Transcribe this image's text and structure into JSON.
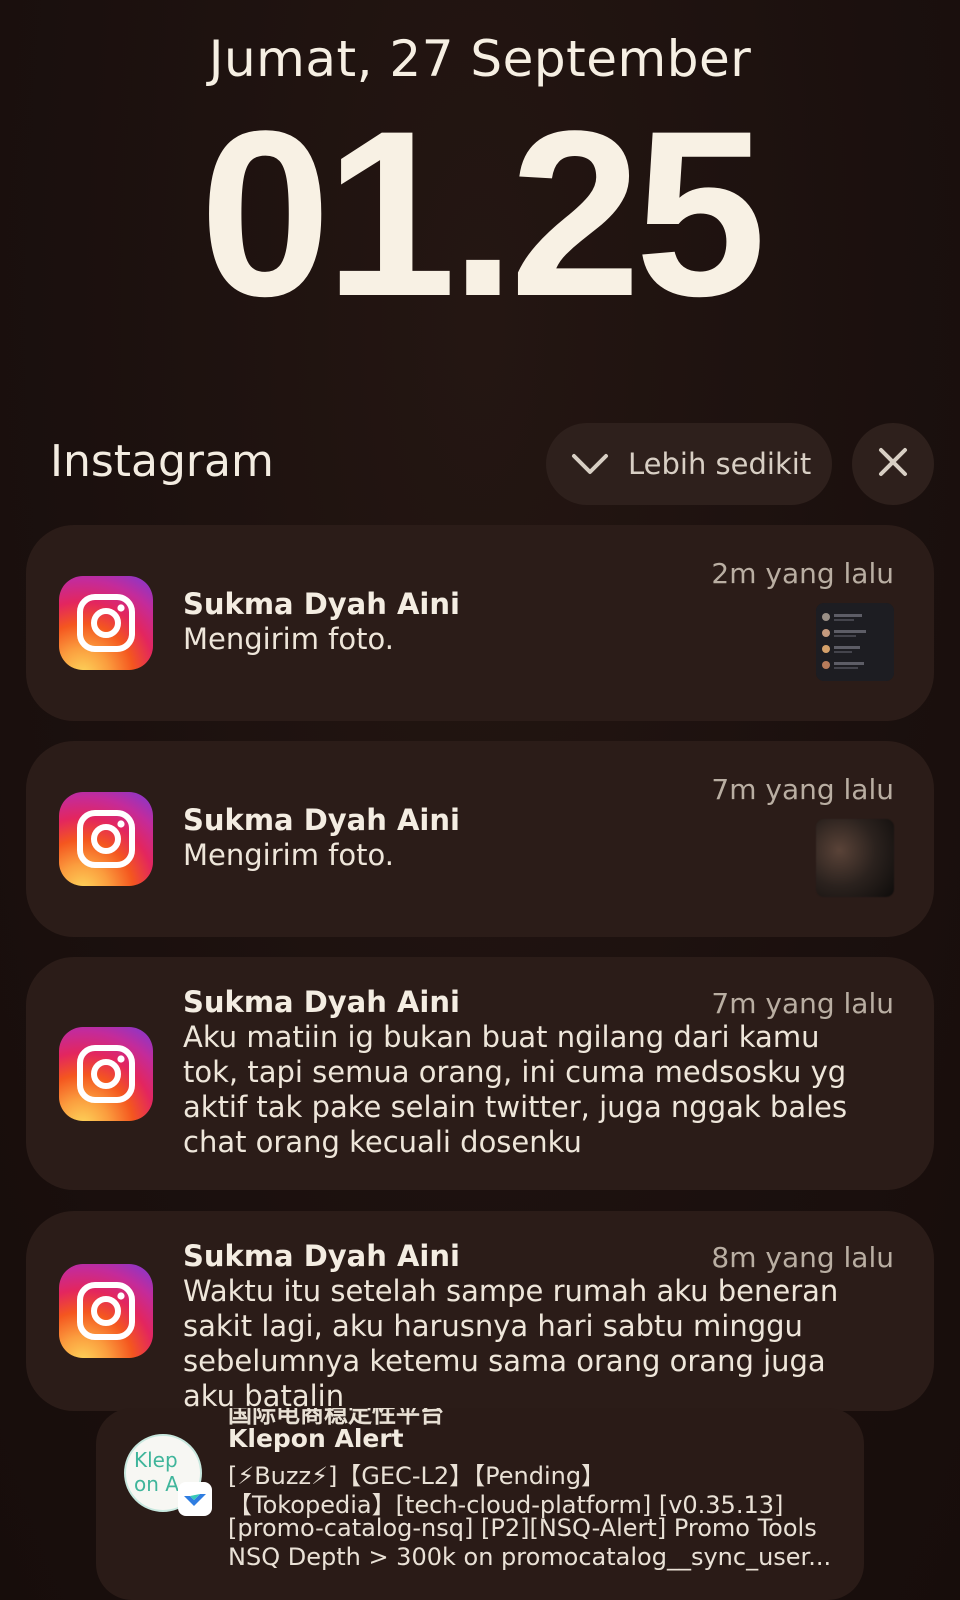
{
  "lockscreen": {
    "date": "Jumat, 27 September",
    "time": "01.25"
  },
  "group": {
    "app_name": "Instagram",
    "collapse_label": "Lebih sedikit"
  },
  "notifications": [
    {
      "icon": "instagram-icon",
      "sender": "Sukma Dyah Aini",
      "message": "Mengirim foto.",
      "time": "2m yang lalu",
      "has_thumbnail": true
    },
    {
      "icon": "instagram-icon",
      "sender": "Sukma Dyah Aini",
      "message": "Mengirim foto.",
      "time": "7m yang lalu",
      "has_thumbnail": true
    },
    {
      "icon": "instagram-icon",
      "sender": "Sukma Dyah Aini",
      "message": "Aku matiin ig bukan buat ngilang dari kamu tok, tapi semua orang, ini cuma medsosku yg aktif tak pake selain twitter, juga nggak bales chat orang kecuali dosenku",
      "time": "7m yang lalu",
      "has_thumbnail": false
    },
    {
      "icon": "instagram-icon",
      "sender": "Sukma Dyah Aini",
      "message": "Waktu itu setelah sampe rumah aku beneran sakit lagi, aku harusnya hari sabtu minggu sebelumnya ketemu sama orang orang juga aku batalin",
      "time": "8m yang lalu",
      "has_thumbnail": false
    }
  ],
  "klepon": {
    "header_partial": "国际电商稳定性平台",
    "title": "Klepon Alert",
    "avatar_text_line1": "Klep",
    "avatar_text_line2": "on A",
    "lines": [
      "[⚡Buzz⚡]【GEC-L2】【Pending】",
      "【Tokopedia】[tech-cloud-platform] [v0.35.13]",
      "[promo-catalog-nsq] [P2][NSQ-Alert] Promo Tools",
      "NSQ Depth > 300k on promocatalog__sync_user..."
    ]
  },
  "colors": {
    "background": "#1c110f",
    "card": "#2b1c18",
    "text": "#f3ece1",
    "muted": "#b9aea2"
  }
}
